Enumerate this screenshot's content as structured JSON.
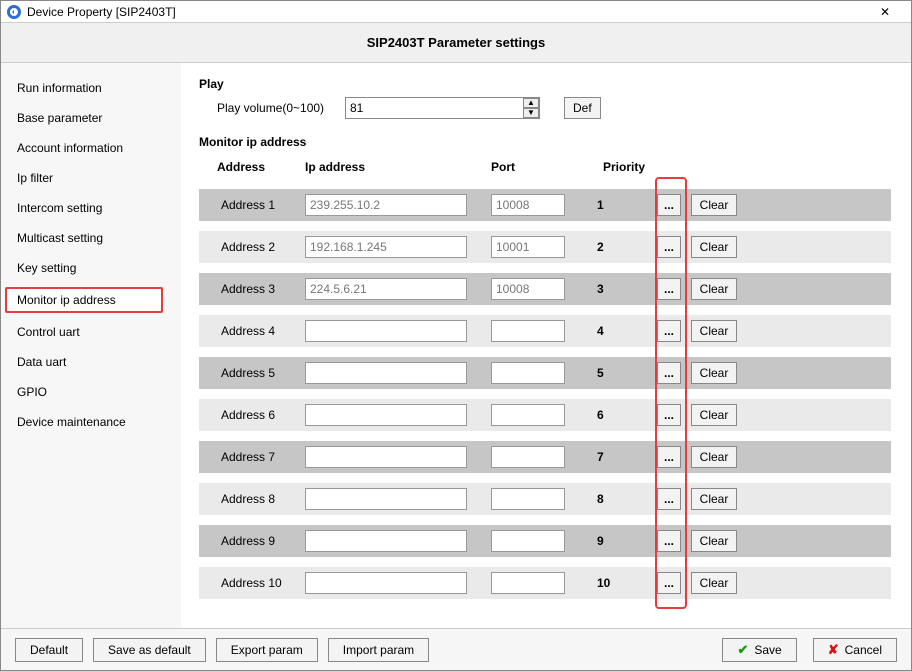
{
  "window": {
    "title": "Device Property [SIP2403T]",
    "heading": "SIP2403T Parameter settings"
  },
  "sidebar": [
    "Run information",
    "Base parameter",
    "Account information",
    "Ip filter",
    "Intercom setting",
    "Multicast setting",
    "Key setting",
    "Monitor ip address",
    "Control uart",
    "Data uart",
    "GPIO",
    "Device maintenance"
  ],
  "play": {
    "section": "Play",
    "volume_label": "Play volume(0~100)",
    "volume_value": "81",
    "def_btn": "Def"
  },
  "monitor": {
    "section": "Monitor ip address",
    "headers": {
      "address": "Address",
      "ip": "Ip address",
      "port": "Port",
      "priority": "Priority"
    },
    "dots_label": "...",
    "clear_label": "Clear",
    "rows": [
      {
        "label": "Address 1",
        "ip": "239.255.10.2",
        "port": "10008",
        "priority": "1"
      },
      {
        "label": "Address 2",
        "ip": "192.168.1.245",
        "port": "10001",
        "priority": "2"
      },
      {
        "label": "Address 3",
        "ip": "224.5.6.21",
        "port": "10008",
        "priority": "3"
      },
      {
        "label": "Address 4",
        "ip": "",
        "port": "",
        "priority": "4"
      },
      {
        "label": "Address 5",
        "ip": "",
        "port": "",
        "priority": "5"
      },
      {
        "label": "Address 6",
        "ip": "",
        "port": "",
        "priority": "6"
      },
      {
        "label": "Address 7",
        "ip": "",
        "port": "",
        "priority": "7"
      },
      {
        "label": "Address 8",
        "ip": "",
        "port": "",
        "priority": "8"
      },
      {
        "label": "Address 9",
        "ip": "",
        "port": "",
        "priority": "9"
      },
      {
        "label": "Address 10",
        "ip": "",
        "port": "",
        "priority": "10"
      }
    ]
  },
  "footer": {
    "default": "Default",
    "save_as_default": "Save as default",
    "export_param": "Export param",
    "import_param": "Import param",
    "save": "Save",
    "cancel": "Cancel"
  }
}
